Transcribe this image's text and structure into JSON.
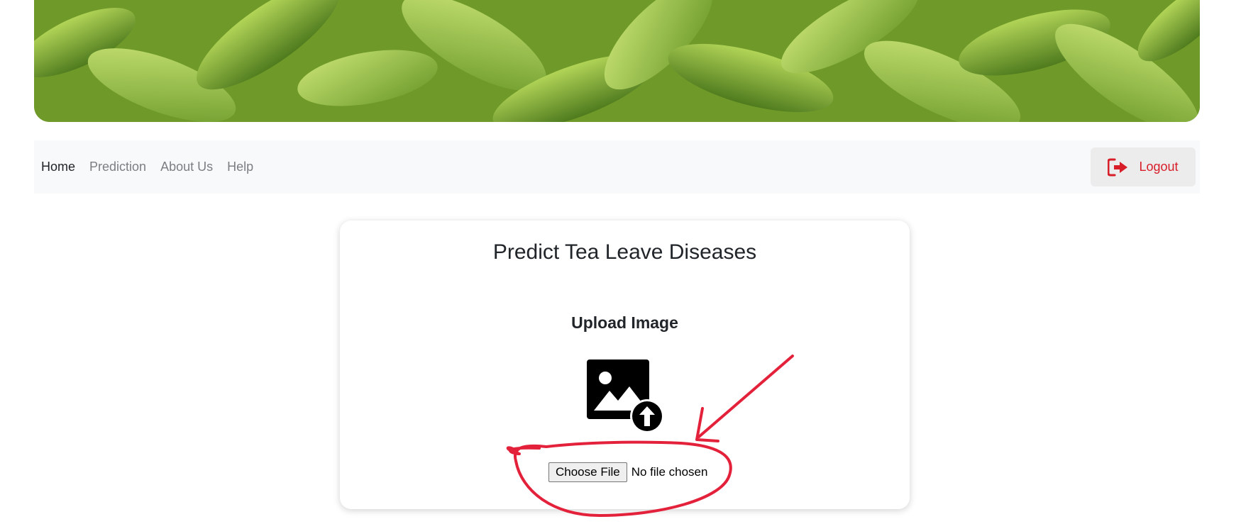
{
  "nav": {
    "links": [
      {
        "label": "Home",
        "active": true
      },
      {
        "label": "Prediction",
        "active": false
      },
      {
        "label": "About Us",
        "active": false
      },
      {
        "label": "Help",
        "active": false
      }
    ],
    "logout_label": "Logout"
  },
  "card": {
    "title": "Predict Tea Leave Diseases",
    "upload_heading": "Upload Image",
    "choose_file_label": "Choose File",
    "file_status": "No file chosen"
  },
  "icons": {
    "logout": "sign-out-icon",
    "upload": "image-upload-icon"
  },
  "colors": {
    "accent_red": "#d81e28",
    "navbar_bg": "#f8f9fa",
    "annotation_red": "#e3213a"
  }
}
